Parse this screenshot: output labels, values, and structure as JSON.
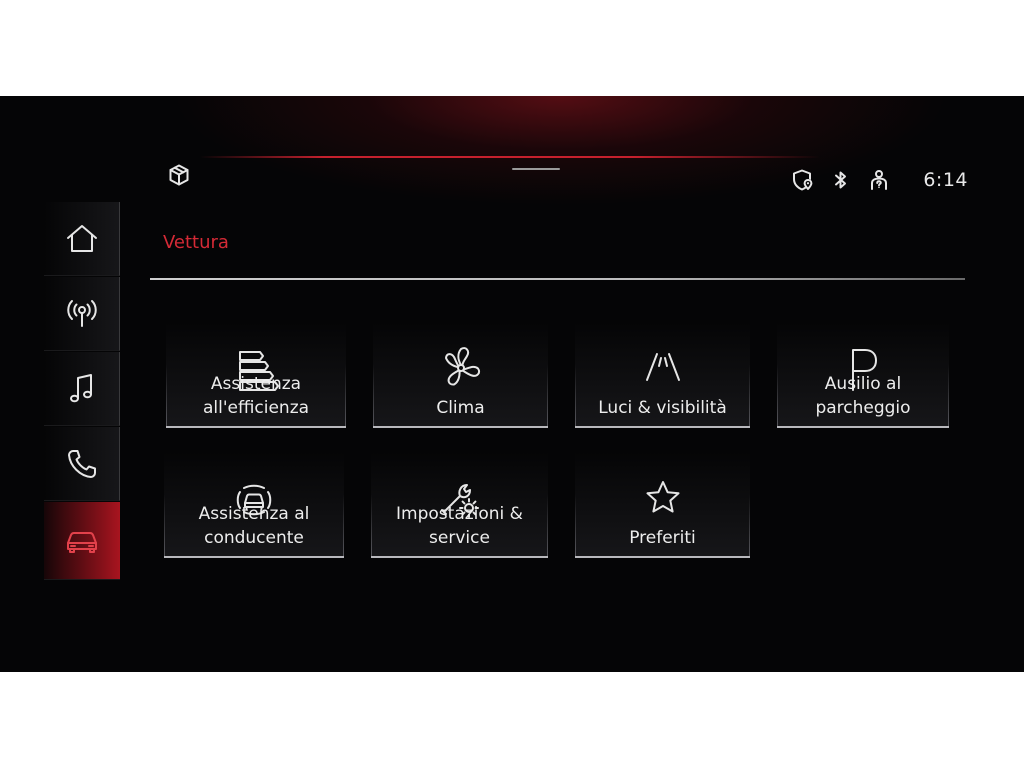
{
  "status": {
    "time": "6:14"
  },
  "header": {
    "title": "Vettura"
  },
  "dock": {
    "items": [
      {
        "name": "home",
        "icon": "home-icon"
      },
      {
        "name": "radio",
        "icon": "radio-antenna-icon"
      },
      {
        "name": "media",
        "icon": "music-note-icon"
      },
      {
        "name": "phone",
        "icon": "phone-icon"
      },
      {
        "name": "car",
        "icon": "car-icon",
        "active": true
      }
    ]
  },
  "tiles": [
    {
      "label": "Assistenza\nall'efficienza",
      "icon": "efficiency-bars-icon"
    },
    {
      "label": "Clima",
      "icon": "fan-icon"
    },
    {
      "label": "Luci & visibilità",
      "icon": "road-lights-icon"
    },
    {
      "label": "Ausilio al\nparcheggio",
      "icon": "parking-p-icon"
    },
    {
      "label": "Assistenza al\nconducente",
      "icon": "driver-assist-car-icon"
    },
    {
      "label": "Impostazioni &\nservice",
      "icon": "wrench-gear-icon"
    },
    {
      "label": "Preferiti",
      "icon": "star-icon"
    }
  ],
  "colors": {
    "accent": "#c5202d",
    "title": "#d52a36",
    "active_dock": "#a8141f",
    "text": "#ededed"
  }
}
